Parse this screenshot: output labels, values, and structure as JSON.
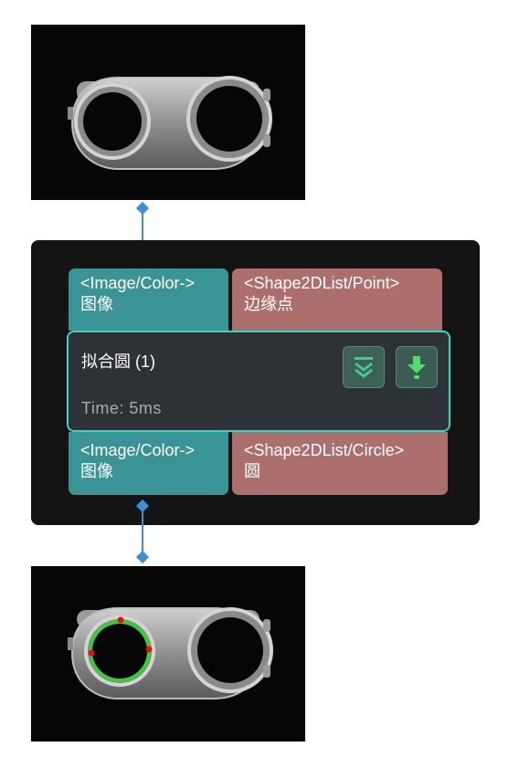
{
  "node": {
    "title": "拟合圆 (1)",
    "time": "Time: 5ms",
    "inputs": [
      {
        "type": "<Image/Color->",
        "label": "图像"
      },
      {
        "type": "<Shape2DList/Point>",
        "label": "边缘点"
      }
    ],
    "outputs": [
      {
        "type": "<Image/Color->",
        "label": "图像"
      },
      {
        "type": "<Shape2DList/Circle>",
        "label": "圆"
      }
    ]
  },
  "colors": {
    "port_image": "#3a9394",
    "port_shape": "#ad6f6d",
    "selected_border": "#3bd5c0",
    "connector": "#3f8fd6",
    "fitted_circle": "#22dd22",
    "edge_points": "#dd1111"
  },
  "icons": {
    "collapse": "double-chevron-down-icon",
    "action": "download-arrow-icon"
  }
}
